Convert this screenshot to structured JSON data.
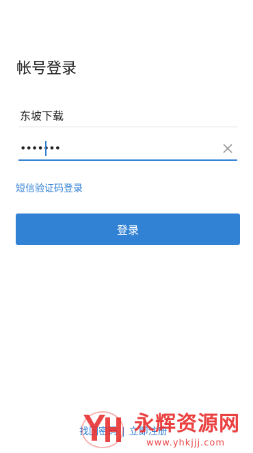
{
  "page": {
    "title": "帐号登录"
  },
  "form": {
    "username_value": "东坡下载",
    "password_masked": "•••••••",
    "sms_login_link": "短信验证码登录",
    "login_button": "登录",
    "clear_icon": "close-icon"
  },
  "footer": {
    "find_password": "找回密码",
    "separator": "|",
    "register": "立即注册"
  },
  "watermark": {
    "title": "永辉资源网",
    "url": "www.yhkjjj.com",
    "logo": "YH"
  },
  "colors": {
    "accent": "#3182d5",
    "link": "#2f7fd3",
    "watermark": "#e72626"
  }
}
